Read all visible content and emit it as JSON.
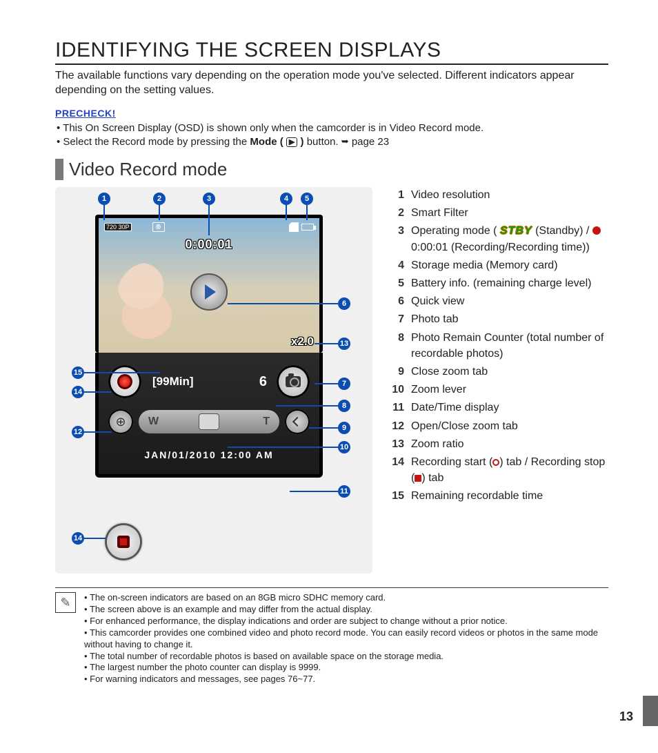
{
  "title": "IDENTIFYING THE SCREEN DISPLAYS",
  "intro": "The available functions vary depending on the operation mode you've selected. Different indicators appear depending on the setting values.",
  "precheck_heading": "PRECHECK!",
  "precheck": {
    "item1": "This On Screen Display (OSD) is shown only when the camcorder is in Video Record mode.",
    "item2_a": "Select the Record mode by pressing the ",
    "item2_b": "Mode (",
    "item2_icon": "▶",
    "item2_c": ")",
    "item2_d": " button. ",
    "item2_arrow": "➥",
    "item2_e": "page 23"
  },
  "section_heading": "Video Record mode",
  "screen": {
    "resolution_label": "720 30P",
    "recording_time": "0:00:01",
    "zoom_ratio": "x2.0",
    "remaining_time": "[99Min]",
    "photo_remain": "6",
    "zoom_W": "W",
    "zoom_T": "T",
    "datetime": "JAN/01/2010 12:00 AM"
  },
  "callouts": {
    "1": "1",
    "2": "2",
    "3": "3",
    "4": "4",
    "5": "5",
    "6": "6",
    "7": "7",
    "8": "8",
    "9": "9",
    "10": "10",
    "11": "11",
    "12": "12",
    "13": "13",
    "14": "14",
    "15": "15",
    "14b": "14"
  },
  "legend": {
    "1": "Video resolution",
    "2": "Smart Filter",
    "3_a": "Operating mode ( ",
    "3_stby": "STBY",
    "3_b": " (Standby) / ",
    "3_c": " 0:00:01 (Recording/Recording time))",
    "4": "Storage media (Memory card)",
    "5": "Battery info. (remaining charge level)",
    "6": "Quick view",
    "7": "Photo tab",
    "8": "Photo Remain Counter (total number of recordable photos)",
    "9": "Close zoom tab",
    "10": "Zoom lever",
    "11": "Date/Time display",
    "12": "Open/Close zoom tab",
    "13": "Zoom ratio",
    "14_a": "Recording start (",
    "14_b": ") tab / Recording stop (",
    "14_c": ") tab",
    "15": "Remaining recordable time"
  },
  "notes": {
    "n1": "The on-screen indicators are based on an 8GB micro SDHC memory card.",
    "n2": "The screen above is an example and may differ from the actual display.",
    "n3": "For enhanced performance, the display indications and order are subject to change without a prior notice.",
    "n4": "This camcorder provides one combined video and photo record mode. You can easily record videos or photos in the same mode without having to change it.",
    "n5": "The total number of recordable photos is based on available space on the storage media.",
    "n6": "The largest number the photo counter can display is 9999.",
    "n7": "For warning indicators and messages, see pages 76~77."
  },
  "page_number": "13"
}
